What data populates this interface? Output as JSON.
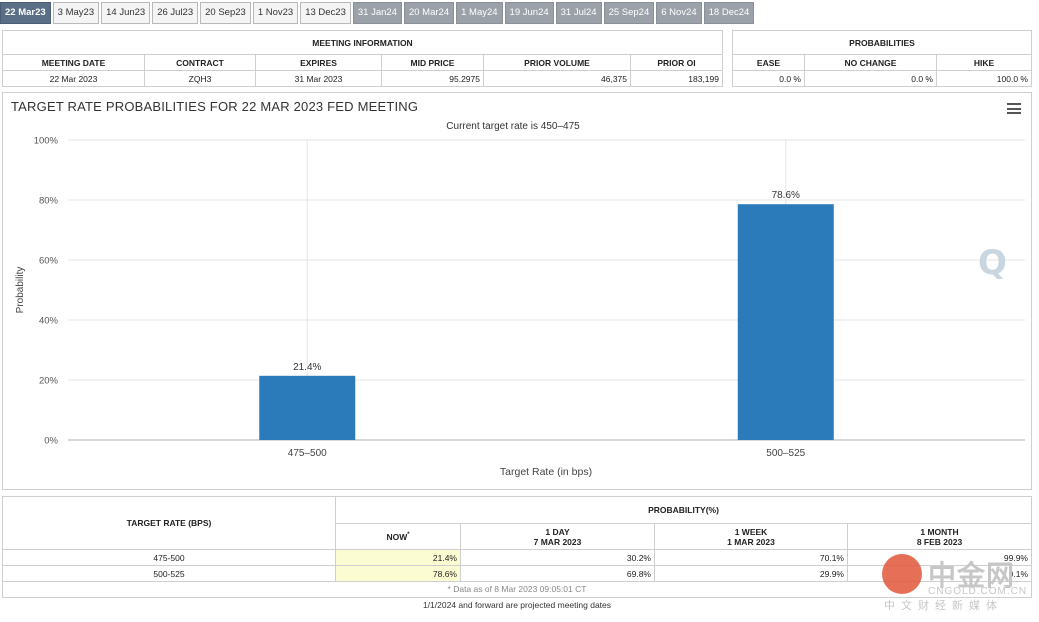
{
  "tabs": [
    {
      "label": "22 Mar23",
      "state": "active"
    },
    {
      "label": "3 May23",
      "state": "normal"
    },
    {
      "label": "14 Jun23",
      "state": "normal"
    },
    {
      "label": "26 Jul23",
      "state": "normal"
    },
    {
      "label": "20 Sep23",
      "state": "normal"
    },
    {
      "label": "1 Nov23",
      "state": "normal"
    },
    {
      "label": "13 Dec23",
      "state": "normal"
    },
    {
      "label": "31 Jan24",
      "state": "projected"
    },
    {
      "label": "20 Mar24",
      "state": "projected"
    },
    {
      "label": "1 May24",
      "state": "projected"
    },
    {
      "label": "19 Jun24",
      "state": "projected"
    },
    {
      "label": "31 Jul24",
      "state": "projected"
    },
    {
      "label": "25 Sep24",
      "state": "projected"
    },
    {
      "label": "6 Nov24",
      "state": "projected"
    },
    {
      "label": "18 Dec24",
      "state": "projected"
    }
  ],
  "meeting_info": {
    "title": "MEETING INFORMATION",
    "headers": [
      "MEETING DATE",
      "CONTRACT",
      "EXPIRES",
      "MID PRICE",
      "PRIOR VOLUME",
      "PRIOR OI"
    ],
    "values": [
      "22 Mar 2023",
      "ZQH3",
      "31 Mar 2023",
      "95.2975",
      "46,375",
      "183,199"
    ]
  },
  "probabilities": {
    "title": "PROBABILITIES",
    "headers": [
      "EASE",
      "NO CHANGE",
      "HIKE"
    ],
    "values": [
      "0.0 %",
      "0.0 %",
      "100.0 %"
    ]
  },
  "chart_data": {
    "type": "bar",
    "title": "TARGET RATE PROBABILITIES FOR 22 MAR 2023 FED MEETING",
    "subtitle": "Current target rate is 450–475",
    "xlabel": "Target Rate (in bps)",
    "ylabel": "Probability",
    "categories": [
      "475–500",
      "500–525"
    ],
    "values": [
      21.4,
      78.6
    ],
    "data_labels": [
      "21.4%",
      "78.6%"
    ],
    "yticks": [
      "0%",
      "20%",
      "40%",
      "60%",
      "80%",
      "100%"
    ],
    "ylim": [
      0,
      100
    ],
    "grid": true,
    "bar_color": "#2b7bba"
  },
  "bottom_table": {
    "col1_header": "TARGET RATE (BPS)",
    "prob_header": "PROBABILITY(%)",
    "now_label": "NOW",
    "now_mark": "*",
    "col_day": "1 DAY",
    "col_day_date": "7 MAR 2023",
    "col_week": "1 WEEK",
    "col_week_date": "1 MAR 2023",
    "col_month": "1 MONTH",
    "col_month_date": "8 FEB 2023",
    "rows": [
      {
        "rate": "475-500",
        "now": "21.4%",
        "day": "30.2%",
        "week": "70.1%",
        "month": "99.9%"
      },
      {
        "rate": "500-525",
        "now": "78.6%",
        "day": "69.8%",
        "week": "29.9%",
        "month": "0.1%"
      }
    ],
    "footnote": "* Data as of 8 Mar 2023 09:05:01 CT",
    "projected_note": "1/1/2024 and forward are projected meeting dates"
  },
  "watermark": {
    "title": "中金网",
    "url": "CNGOLD.COM.CN",
    "sub": "中文财经新媒体"
  }
}
